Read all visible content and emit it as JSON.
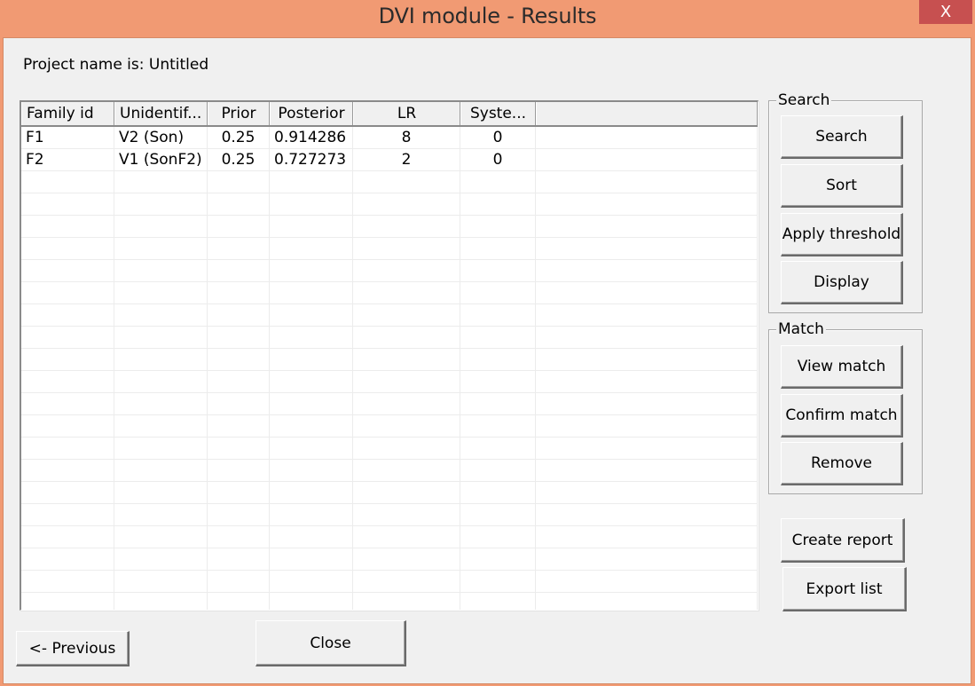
{
  "window": {
    "title": "DVI module - Results",
    "close_icon": "X"
  },
  "project_label": "Project name is: Untitled",
  "table": {
    "columns": [
      "Family id",
      "Unidentif...",
      "Prior",
      "Posterior",
      "LR",
      "Syste...",
      ""
    ],
    "rows": [
      [
        "F1",
        "V2 (Son)",
        "0.25",
        "0.914286",
        "8",
        "0",
        ""
      ],
      [
        "F2",
        "V1 (SonF2)",
        "0.25",
        "0.727273",
        "2",
        "0",
        ""
      ]
    ]
  },
  "search_group": {
    "legend": "Search",
    "buttons": [
      "Search",
      "Sort",
      "Apply threshold",
      "Display"
    ]
  },
  "match_group": {
    "legend": "Match",
    "buttons": [
      "View match",
      "Confirm match",
      "Remove"
    ]
  },
  "actions": {
    "create_report": "Create report",
    "export_list": "Export list",
    "previous": "<- Previous",
    "close": "Close"
  },
  "colors": {
    "titlebar": "#f19a73",
    "close_button": "#c75050",
    "client_bg": "#f0f0f0"
  }
}
